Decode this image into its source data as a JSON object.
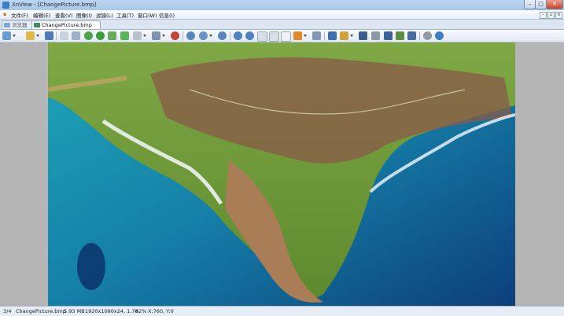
{
  "window": {
    "title": "XnView - [ChangePicture.bmp]",
    "minimize": "–",
    "maximize": "□",
    "close": "✕"
  },
  "menubar": {
    "items": [
      "文件(F)",
      "编辑(E)",
      "查看(V)",
      "图像(I)",
      "滤镜(L)",
      "工具(T)",
      "窗口(W)",
      "信息(I)"
    ]
  },
  "tabs": [
    {
      "label": "浏览器",
      "active": false
    },
    {
      "label": "ChangePicture.bmp",
      "active": true
    }
  ],
  "toolbar": {
    "icons": [
      "browse-icon",
      "open-folder-icon",
      "save-icon",
      "print-preview-icon",
      "properties-icon",
      "globe-icon",
      "refresh-icon",
      "copy-icon",
      "paste-icon",
      "adjust-icon",
      "resize-icon",
      "color-icon",
      "zoom-in-icon",
      "zoom-fit-icon",
      "zoom-out-icon",
      "previous-icon",
      "next-icon",
      "first-icon",
      "last-icon",
      "slideshow-icon",
      "crop-icon",
      "rotate-icon",
      "fullscreen-icon",
      "capture-icon",
      "search-icon",
      "print-icon",
      "scanner-icon",
      "photo-icon",
      "camera-icon",
      "settings-icon",
      "info-icon"
    ]
  },
  "image": {
    "subject": "Aerial view of coastal headland with turquoise sea"
  },
  "status": {
    "index": "3/4",
    "filename": "ChangePicture.bmp",
    "filesize": "5.93 MB",
    "dimensions": "1920x1080x24, 1.78",
    "zoom": "62%",
    "coords": "X:760, Y:0"
  },
  "colors": {
    "accent": "#3d7fc4",
    "titlebar": "#b8d4ee",
    "viewer_bg": "#b5b5b5",
    "close": "#c8442c"
  }
}
